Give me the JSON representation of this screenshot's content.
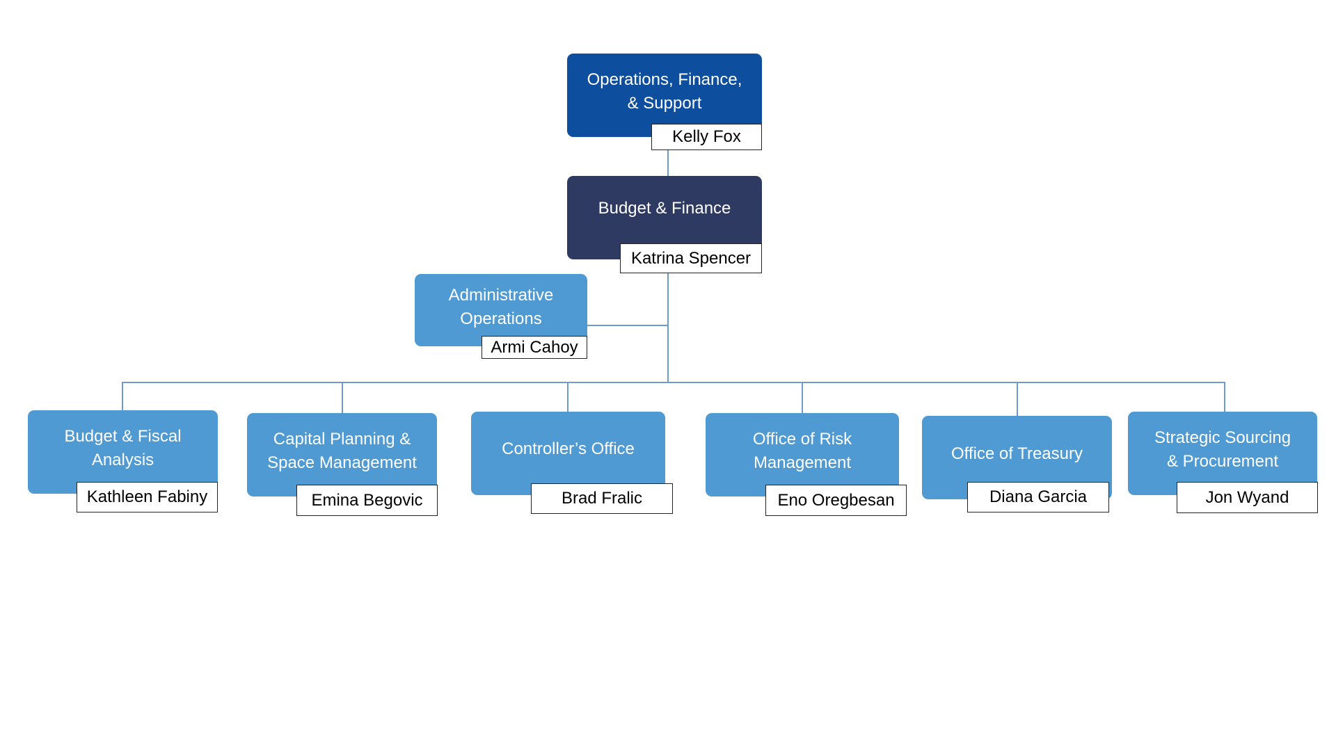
{
  "chart": {
    "root": {
      "title": "Operations, Finance,\n& Support",
      "name": "Kelly Fox",
      "color": "#0d4f9e"
    },
    "department": {
      "title": "Budget & Finance",
      "name": "Katrina Spencer",
      "color": "#2f3a62"
    },
    "assistant": {
      "title": "Administrative\nOperations",
      "name": "Armi Cahoy",
      "color": "#4f9ad3"
    },
    "children": [
      {
        "title": "Budget & Fiscal\nAnalysis",
        "name": "Kathleen Fabiny"
      },
      {
        "title": "Capital Planning &\nSpace Management",
        "name": "Emina Begovic"
      },
      {
        "title": "Controller’s Office",
        "name": "Brad Fralic"
      },
      {
        "title": "Office of Risk\nManagement",
        "name": "Eno Oregbesan"
      },
      {
        "title": "Office of Treasury",
        "name": "Diana Garcia"
      },
      {
        "title": "Strategic Sourcing\n& Procurement",
        "name": "Jon Wyand"
      }
    ],
    "connector_color": "#6d9bd0",
    "child_color": "#4f9ad3"
  }
}
